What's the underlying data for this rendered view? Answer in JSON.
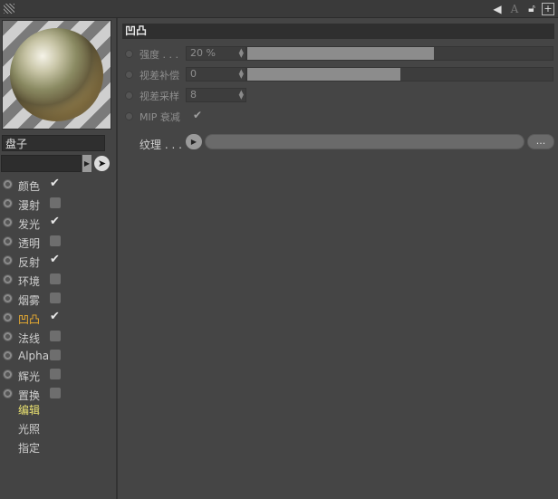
{
  "top_icons": [
    "arrow-left-icon",
    "text-a-icon",
    "lock-icon",
    "add-panel-icon"
  ],
  "material": {
    "name": "盘子"
  },
  "channels": [
    {
      "label": "颜色",
      "checked": true,
      "active": false
    },
    {
      "label": "漫射",
      "checked": false,
      "active": false
    },
    {
      "label": "发光",
      "checked": true,
      "active": false
    },
    {
      "label": "透明",
      "checked": false,
      "active": false
    },
    {
      "label": "反射",
      "checked": true,
      "active": false
    },
    {
      "label": "环境",
      "checked": false,
      "active": false
    },
    {
      "label": "烟雾",
      "checked": false,
      "active": false
    },
    {
      "label": "凹凸",
      "checked": true,
      "active": true
    },
    {
      "label": "法线",
      "checked": false,
      "active": false
    },
    {
      "label": "Alpha",
      "checked": false,
      "active": false
    },
    {
      "label": "辉光",
      "checked": false,
      "active": false
    },
    {
      "label": "置换",
      "checked": false,
      "active": false
    }
  ],
  "sub_items": [
    {
      "label": "编辑",
      "active": true
    },
    {
      "label": "光照",
      "active": false
    },
    {
      "label": "指定",
      "active": false
    }
  ],
  "section": {
    "title": "凹凸",
    "strength": {
      "label": "强度 . . .",
      "value": "20 %",
      "fill_fraction": 0.61
    },
    "parallax_offset": {
      "label": "视差补偿",
      "value": "0",
      "fill_fraction": 0.5
    },
    "parallax_samples": {
      "label": "视差采样",
      "value": "8"
    },
    "mip_falloff": {
      "label": "MIP 衰减",
      "checked": true
    },
    "texture": {
      "label": "纹理 . . .",
      "more_label": "..."
    }
  }
}
